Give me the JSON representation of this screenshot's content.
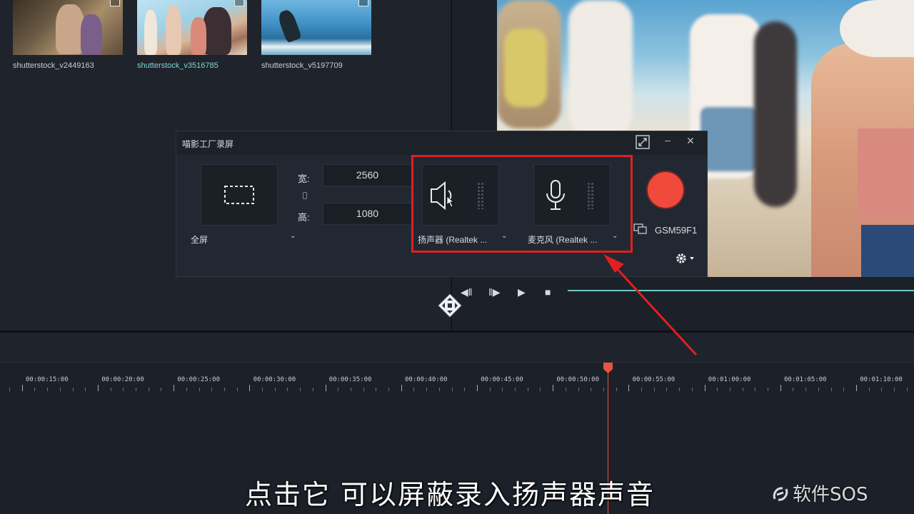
{
  "library": {
    "items": [
      {
        "name": "shutterstock_v2449163",
        "selected": false
      },
      {
        "name": "shutterstock_v3516785",
        "selected": true
      },
      {
        "name": "shutterstock_v5197709",
        "selected": false
      }
    ]
  },
  "recorder": {
    "title": "喵影工厂录屏",
    "mode_label": "全屏",
    "width_label": "宽:",
    "width_value": "2560",
    "height_label": "高:",
    "height_value": "1080",
    "speaker_label": "扬声器 (Realtek ...",
    "mic_label": "麦克风 (Realtek ...",
    "display_label": "GSM59F1"
  },
  "timeline": {
    "timecodes": [
      "00:00:15:00",
      "00:00:20:00",
      "00:00:25:00",
      "00:00:30:00",
      "00:00:35:00",
      "00:00:40:00",
      "00:00:45:00",
      "00:00:50:00",
      "00:00:55:00",
      "00:01:00:00",
      "00:01:05:00",
      "00:01:10:00"
    ]
  },
  "subtitle": "点击它  可以屏蔽录入扬声器声音",
  "watermark": "软件SOS",
  "colors": {
    "accent": "#6fc9c4",
    "record": "#f04a3c",
    "highlight": "#e01f1f",
    "playhead": "#e8553f"
  }
}
